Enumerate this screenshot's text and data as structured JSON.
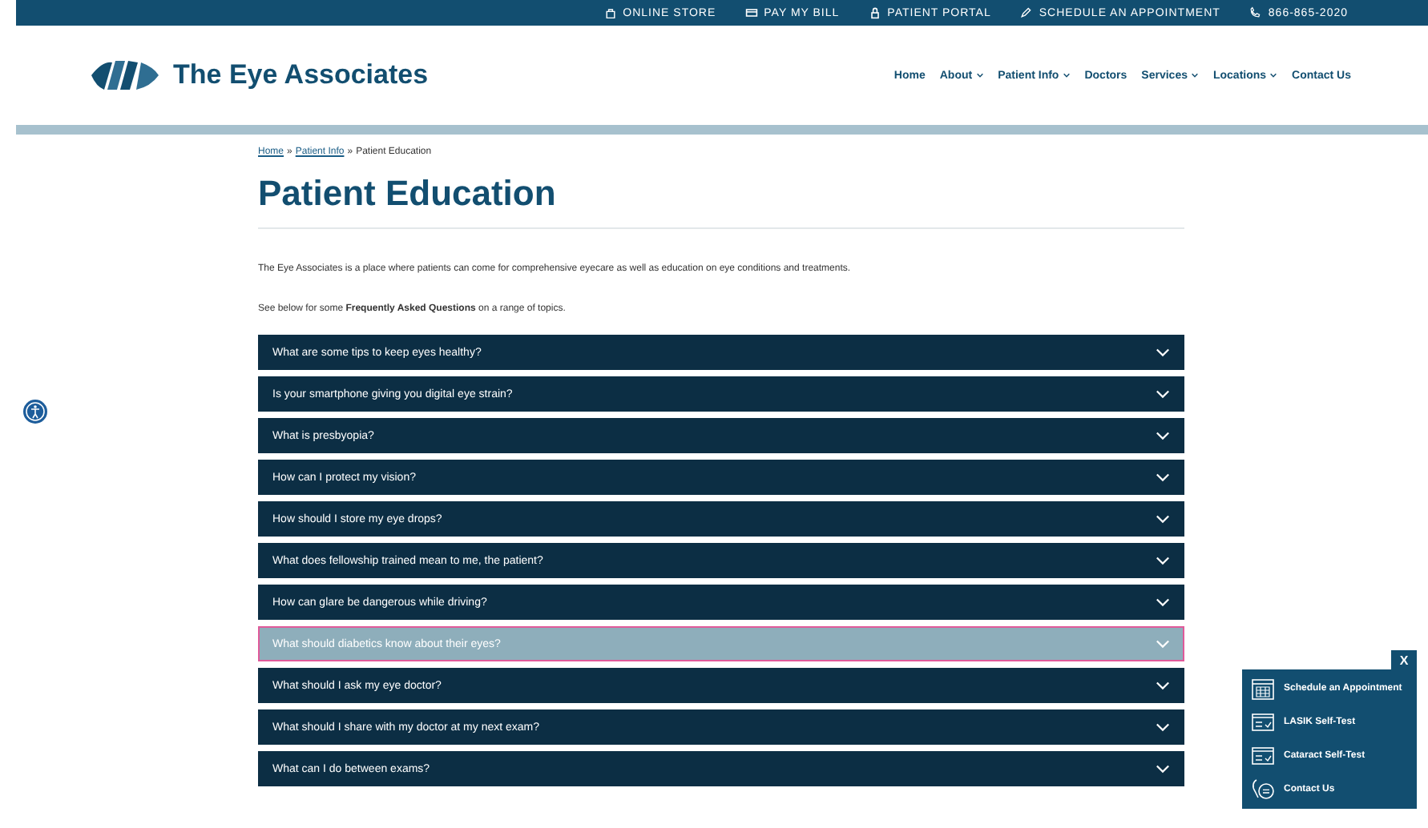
{
  "top_bar": {
    "links": [
      {
        "kind": "store",
        "label": "ONLINE STORE"
      },
      {
        "kind": "bill",
        "label": "PAY MY BILL"
      },
      {
        "kind": "portal",
        "label": "PATIENT PORTAL"
      },
      {
        "kind": "schedule",
        "label": "SCHEDULE AN APPOINTMENT"
      },
      {
        "kind": "phone",
        "label": "866-865-2020"
      }
    ]
  },
  "header": {
    "logo_text": "The Eye Associates",
    "nav": [
      {
        "label": "Home",
        "dropdown": false
      },
      {
        "label": "About",
        "dropdown": true
      },
      {
        "label": "Patient Info",
        "dropdown": true
      },
      {
        "label": "Doctors",
        "dropdown": false
      },
      {
        "label": "Services",
        "dropdown": true
      },
      {
        "label": "Locations",
        "dropdown": true
      },
      {
        "label": "Contact Us",
        "dropdown": false
      }
    ]
  },
  "breadcrumb": {
    "links": [
      "Home",
      "Patient Info"
    ],
    "separator": "»",
    "current": "Patient Education"
  },
  "title": "Patient Education",
  "paragraphs": [
    "The Eye Associates is a place where patients can come for comprehensive eyecare as well as education on eye conditions and treatments.",
    "See below for some **Frequently Asked Questions** on a range of topics."
  ],
  "faq": [
    {
      "question": "What are some tips to keep eyes healthy?",
      "selected": false
    },
    {
      "question": "Is your smartphone giving you digital eye strain?",
      "selected": false
    },
    {
      "question": "What is presbyopia?",
      "selected": false
    },
    {
      "question": "How can I protect my vision?",
      "selected": false
    },
    {
      "question": "How should I store my eye drops?",
      "selected": false
    },
    {
      "question": "What does fellowship trained mean to me, the patient?",
      "selected": false
    },
    {
      "question": "How can glare be dangerous while driving?",
      "selected": false
    },
    {
      "question": "What should diabetics know about their eyes?",
      "selected": true
    },
    {
      "question": "What should I ask my eye doctor?",
      "selected": false
    },
    {
      "question": "What should I share with my doctor at my next exam?",
      "selected": false
    },
    {
      "question": "What can I do between exams?",
      "selected": false
    }
  ],
  "widget": {
    "close": "X",
    "items": [
      {
        "kind": "calendar",
        "label": "Schedule an Appointment"
      },
      {
        "kind": "test",
        "label": "LASIK Self-Test"
      },
      {
        "kind": "test",
        "label": "Cataract Self-Test"
      },
      {
        "kind": "contact",
        "label": "Contact Us"
      }
    ]
  }
}
